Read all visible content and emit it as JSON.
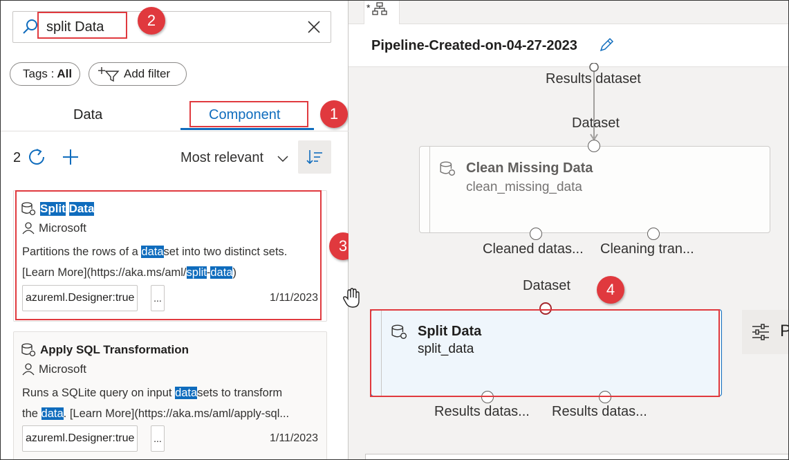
{
  "search": {
    "value": "split Data"
  },
  "filters": {
    "tags_label": "Tags :",
    "tags_value": "All",
    "add_filter": "Add filter"
  },
  "tabs": [
    {
      "label": "Data"
    },
    {
      "label": "Component"
    }
  ],
  "list": {
    "count": "2",
    "sort_label": "Most relevant"
  },
  "cards": [
    {
      "title_parts": [
        "Split",
        "Data"
      ],
      "publisher": "Microsoft",
      "desc_line1": [
        "Partitions the rows of a ",
        "data",
        "set into two distinct sets."
      ],
      "desc_line2": [
        "[Learn More](https://aka.ms/aml/",
        "split",
        "-",
        "data",
        ")"
      ],
      "tag": "azureml.Designer:true",
      "more": "...",
      "date": "1/11/2023"
    },
    {
      "title": "Apply SQL Transformation",
      "publisher": "Microsoft",
      "desc_line1": [
        "Runs a SQLite query on input ",
        "data",
        "sets to transform"
      ],
      "desc_line2": [
        "the ",
        "data",
        ". [Learn More](https://aka.ms/aml/apply-sql..."
      ],
      "tag": "azureml.Designer:true",
      "more": "...",
      "date": "1/11/2023"
    }
  ],
  "canvas": {
    "tab_marker": "*",
    "pipeline_name": "Pipeline-Created-on-04-27-2023",
    "labels": {
      "results_dataset": "Results dataset",
      "dataset_in": "Dataset",
      "cleaned": "Cleaned datas...",
      "cleaning": "Cleaning tran...",
      "dataset_in2": "Dataset",
      "results_out1": "Results datas...",
      "results_out2": "Results datas..."
    },
    "node_clean": {
      "title": "Clean Missing Data",
      "sub": "clean_missing_data"
    },
    "node_split": {
      "title": "Split Data",
      "sub": "split_data"
    },
    "properties_label": "P"
  },
  "annotations": [
    "1",
    "2",
    "3",
    "4"
  ],
  "colors": {
    "accent": "#0f6cbd",
    "annotation": "#e0393e"
  }
}
